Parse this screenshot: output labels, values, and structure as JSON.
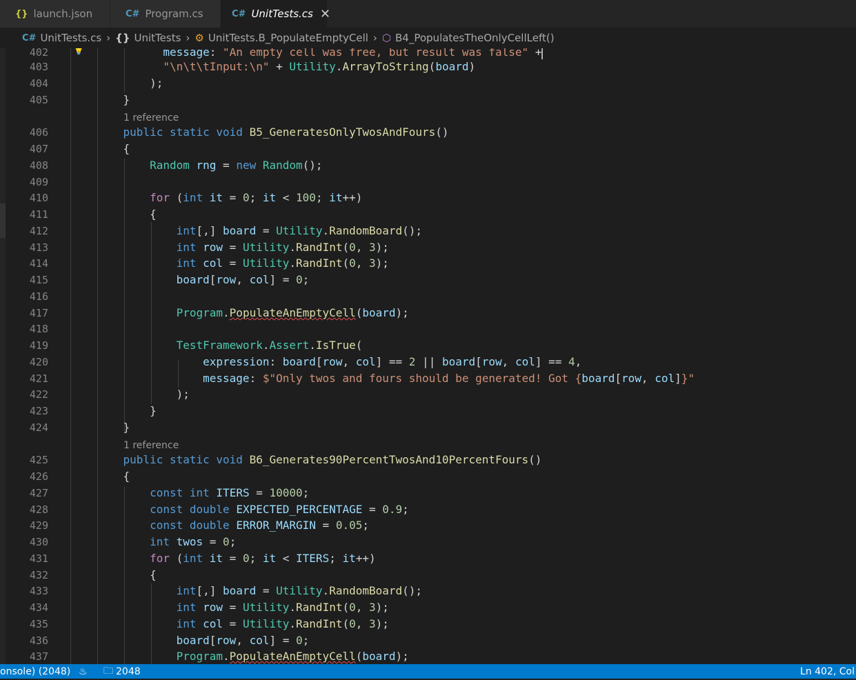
{
  "tabs": [
    {
      "label": "launch.json",
      "icon": "json-braces-icon",
      "glyph": "{}"
    },
    {
      "label": "Program.cs",
      "icon": "csharp-file-icon",
      "glyph": "C#"
    },
    {
      "label": "UnitTests.cs",
      "icon": "csharp-file-icon",
      "glyph": "C#",
      "active": true,
      "close": "✕"
    }
  ],
  "breadcrumb": [
    {
      "label": "UnitTests.cs",
      "icon": "csharp-file-icon",
      "glyph": "C#"
    },
    {
      "label": "UnitTests",
      "icon": "namespace-braces-icon",
      "glyph": "{}"
    },
    {
      "label": "UnitTests.B_PopulateEmptyCell",
      "icon": "class-icon",
      "glyph": "⚙"
    },
    {
      "label": "B4_PopulatesTheOnlyCellLeft()",
      "icon": "method-cube-icon",
      "glyph": "⬡"
    }
  ],
  "codelens": [
    "1 reference",
    "1 reference"
  ],
  "line_numbers": [
    "402",
    "403",
    "404",
    "405",
    "406",
    "407",
    "408",
    "409",
    "410",
    "411",
    "412",
    "413",
    "414",
    "415",
    "416",
    "417",
    "418",
    "419",
    "420",
    "421",
    "422",
    "423",
    "424",
    "425",
    "426",
    "427",
    "428",
    "429",
    "430",
    "431",
    "432",
    "433",
    "434",
    "435",
    "436",
    "437"
  ],
  "status": {
    "left_fragment": "onsole) (2048)",
    "branch_glyph": "♨",
    "folder_label": "2048",
    "position": "Ln 402, Col"
  },
  "colors": {
    "background": "#1e1e1e",
    "statusbar": "#007acc",
    "keyword": "#569cd6",
    "type": "#4ec9b0",
    "function": "#dcdcaa",
    "string": "#ce9178",
    "number": "#b5cea8"
  }
}
